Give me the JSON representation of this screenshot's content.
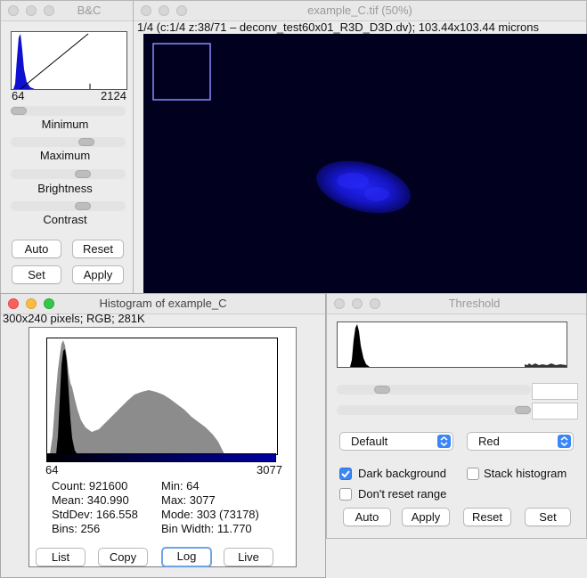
{
  "bc": {
    "title": "B&C",
    "range_min": "64",
    "range_max": "2124",
    "labels": {
      "minimum": "Minimum",
      "maximum": "Maximum",
      "brightness": "Brightness",
      "contrast": "Contrast"
    },
    "buttons": {
      "auto": "Auto",
      "reset": "Reset",
      "set": "Set",
      "apply": "Apply"
    }
  },
  "image": {
    "title": "example_C.tif (50%)",
    "info": "1/4 (c:1/4 z:38/71 – deconv_test60x01_R3D_D3D.dv); 103.44x103.44 microns"
  },
  "histogram": {
    "title": "Histogram of example_C",
    "info": "300x240 pixels; RGB; 281K",
    "axis_min": "64",
    "axis_max": "3077",
    "stats": {
      "count": "Count: 921600",
      "mean": "Mean: 340.990",
      "stddev": "StdDev: 166.558",
      "bins": "Bins: 256",
      "min": "Min: 64",
      "max": "Max: 3077",
      "mode": "Mode: 303 (73178)",
      "binwidth": "Bin Width: 11.770"
    },
    "buttons": {
      "list": "List",
      "copy": "Copy",
      "log": "Log",
      "live": "Live"
    }
  },
  "threshold": {
    "title": "Threshold",
    "method": "Default",
    "mode": "Red",
    "dark_background": "Dark background",
    "stack_histogram": "Stack histogram",
    "dont_reset": "Don't reset range",
    "dark_background_checked": true,
    "stack_histogram_checked": false,
    "dont_reset_checked": false,
    "buttons": {
      "auto": "Auto",
      "apply": "Apply",
      "reset": "Reset",
      "set": "Set"
    }
  },
  "colors": {
    "accent": "#3b86f7",
    "image_bg": "#01011f",
    "nucleus": "#1a1ae6"
  }
}
